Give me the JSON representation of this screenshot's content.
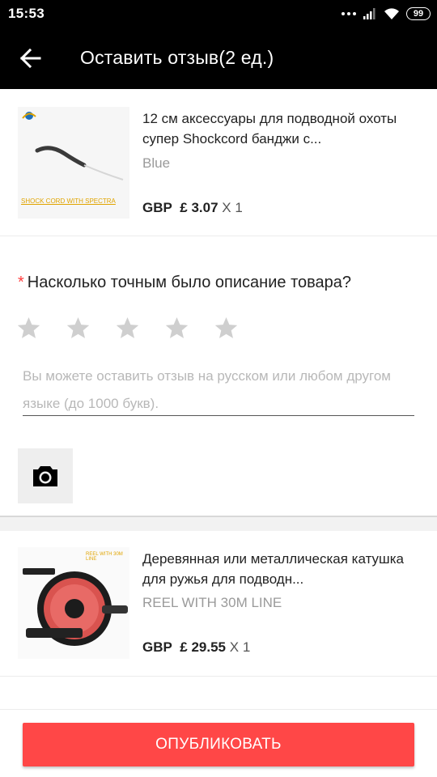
{
  "status_bar": {
    "time": "15:53",
    "battery": "99"
  },
  "header": {
    "title": "Оставить отзыв(2 ед.)",
    "back_icon": "arrow-left-icon"
  },
  "products": [
    {
      "name": "12 см аксессуары для подводной охоты супер Shockcord банджи с...",
      "variant": "Blue",
      "currency": "GBP",
      "price": "£ 3.07",
      "quantity": "X 1",
      "image_caption": "SHOCK CORD WITH SPECTRA"
    },
    {
      "name": "Деревянная или металлическая катушка для ружья для подводн...",
      "variant": "REEL WITH 30M LINE",
      "currency": "GBP",
      "price": "£ 29.55",
      "quantity": "X 1",
      "image_caption": "REEL WITH 30M LINE"
    }
  ],
  "review": {
    "required_mark": "*",
    "question": "Насколько точным было описание товара?",
    "rating": 0,
    "rating_max": 5,
    "placeholder": "Вы можете оставить отзыв на русском или любом другом языке (до 1000 букв).",
    "camera_icon": "camera-icon"
  },
  "footer": {
    "publish_label": "ОПУБЛИКОВАТЬ"
  },
  "colors": {
    "accent": "#ff4747",
    "required": "#ff3d3d",
    "star_empty": "#cfcfcf",
    "bar": "#000000"
  }
}
